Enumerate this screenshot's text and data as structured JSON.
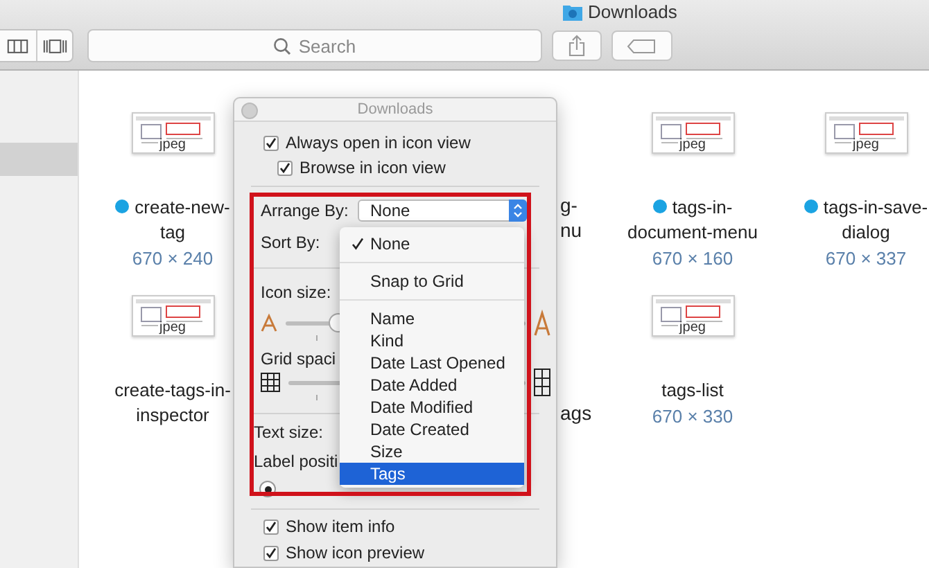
{
  "window": {
    "title": "Downloads"
  },
  "toolbar": {
    "search": {
      "placeholder": "Search"
    }
  },
  "sidebar": {
    "rows": [
      {
        "selected": false
      },
      {
        "selected": false
      },
      {
        "selected": true
      },
      {
        "selected": false
      }
    ]
  },
  "files": [
    {
      "kind": "file",
      "name": "create-new-tag",
      "badge": "jpeg",
      "dimensions": "670 × 240",
      "tagged": true
    },
    {
      "kind": "hidden"
    },
    {
      "kind": "fragment",
      "lines": [
        "g-",
        "nu"
      ]
    },
    {
      "kind": "file",
      "name": "tags-in-document-menu",
      "badge": "jpeg",
      "dimensions": "670 × 160",
      "tagged": true
    },
    {
      "kind": "file",
      "name": "tags-in-save-dialog",
      "badge": "jpeg",
      "dimensions": "670 × 337",
      "tagged": true
    },
    {
      "kind": "file",
      "name": "create-tags-in-inspector",
      "badge": "jpeg",
      "tagged": false
    },
    {
      "kind": "hidden"
    },
    {
      "kind": "fragment",
      "lines": [
        "ags"
      ]
    },
    {
      "kind": "file",
      "name": "tags-list",
      "badge": "jpeg",
      "dimensions": "670 × 330",
      "tagged": false
    }
  ],
  "view_options": {
    "title": "Downloads",
    "top_checkboxes": [
      {
        "label": "Always open in icon view",
        "checked": true
      },
      {
        "label": "Browse in icon view",
        "checked": true
      }
    ],
    "arrange_by": {
      "label": "Arrange By:",
      "value": "None"
    },
    "sort_by": {
      "label": "Sort By:"
    },
    "icon_size": {
      "label": "Icon size:",
      "level": 0.22
    },
    "grid_spacing": {
      "label": "Grid spaci"
    },
    "text_size": {
      "label": "Text size:"
    },
    "label_position": {
      "label": "Label positi",
      "options": [
        {
          "selected": true
        }
      ]
    },
    "bottom_checkboxes": [
      {
        "label": "Show item info",
        "checked": true
      },
      {
        "label": "Show icon preview",
        "checked": true
      }
    ]
  },
  "sort_menu": {
    "items": [
      {
        "kind": "item",
        "label": "None",
        "checked": true,
        "selected": false
      },
      {
        "kind": "separator"
      },
      {
        "kind": "item",
        "label": "Snap to Grid",
        "checked": false,
        "selected": false
      },
      {
        "kind": "separator"
      },
      {
        "kind": "item",
        "label": "Name",
        "checked": false,
        "selected": false
      },
      {
        "kind": "item",
        "label": "Kind",
        "checked": false,
        "selected": false
      },
      {
        "kind": "item",
        "label": "Date Last Opened",
        "checked": false,
        "selected": false
      },
      {
        "kind": "item",
        "label": "Date Added",
        "checked": false,
        "selected": false
      },
      {
        "kind": "item",
        "label": "Date Modified",
        "checked": false,
        "selected": false
      },
      {
        "kind": "item",
        "label": "Date Created",
        "checked": false,
        "selected": false
      },
      {
        "kind": "item",
        "label": "Size",
        "checked": false,
        "selected": false
      },
      {
        "kind": "item",
        "label": "Tags",
        "checked": false,
        "selected": true
      }
    ]
  },
  "highlight": {
    "color": "#d0121b"
  }
}
